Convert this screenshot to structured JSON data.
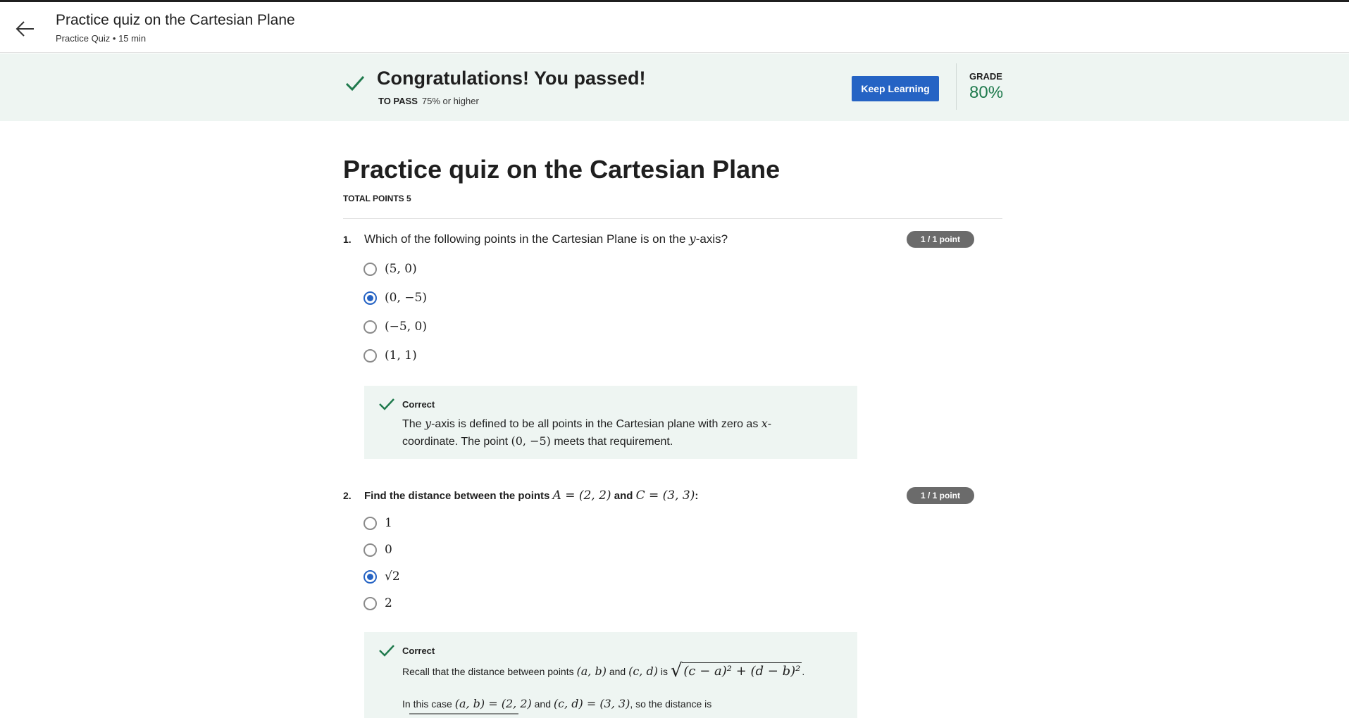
{
  "header": {
    "title": "Practice quiz on the Cartesian Plane",
    "subtitle": "Practice Quiz • 15 min",
    "back_icon": "arrow-left-icon"
  },
  "banner": {
    "message": "Congratulations! You passed!",
    "to_pass_label": "TO PASS",
    "to_pass_value": "75% or higher",
    "button_label": "Keep Learning",
    "grade_label": "GRADE",
    "grade_value": "80%",
    "accent_color": "#1f7a4d",
    "button_color": "#2563c4"
  },
  "quiz": {
    "title": "Practice quiz on the Cartesian Plane",
    "total_points": "TOTAL POINTS 5"
  },
  "questions": [
    {
      "number": "1.",
      "text_before": "Which of the following points in the Cartesian Plane is on the ",
      "text_math": "y",
      "text_after": "-axis?",
      "badge": "1 / 1 point",
      "options": [
        {
          "label": "(5, 0)",
          "selected": false
        },
        {
          "label": "(0, −5)",
          "selected": true
        },
        {
          "label": "(−5, 0)",
          "selected": false
        },
        {
          "label": "(1, 1)",
          "selected": false
        }
      ],
      "feedback": {
        "status": "Correct",
        "line1_a": "The ",
        "line1_math": "y",
        "line1_b": "-axis is defined to be all points in the Cartesian plane with zero as ",
        "line1_math2": "x",
        "line1_c": "-",
        "line2_a": "coordinate. The point ",
        "line2_math": "(0, −5)",
        "line2_b": " meets that requirement."
      }
    },
    {
      "number": "2.",
      "text_before": "Find the distance between the points ",
      "text_math1": "A = (2, 2)",
      "text_mid": " and ",
      "text_math2": "C = (3, 3)",
      "text_after": ":",
      "badge": "1 / 1 point",
      "options": [
        {
          "label": "1",
          "selected": false
        },
        {
          "label": "0",
          "selected": false
        },
        {
          "label": "√2",
          "selected": true
        },
        {
          "label": "2",
          "selected": false
        }
      ],
      "feedback": {
        "status": "Correct",
        "line1_a": "Recall that the distance between points ",
        "line1_math1": "(a, b)",
        "line1_b": " and ",
        "line1_math2": "(c, d)",
        "line1_c": " is ",
        "line1_sqrt": "(c − a)² + (d − b)²",
        "line1_end": ".",
        "line2_a": "In this case ",
        "line2_math1": "(a, b) = (2, 2)",
        "line2_b": " and ",
        "line2_math2": "(c, d) = (3, 3)",
        "line2_c": ", so the distance is"
      }
    }
  ],
  "icons": {
    "check": "check-icon",
    "radio": "radio-button"
  }
}
